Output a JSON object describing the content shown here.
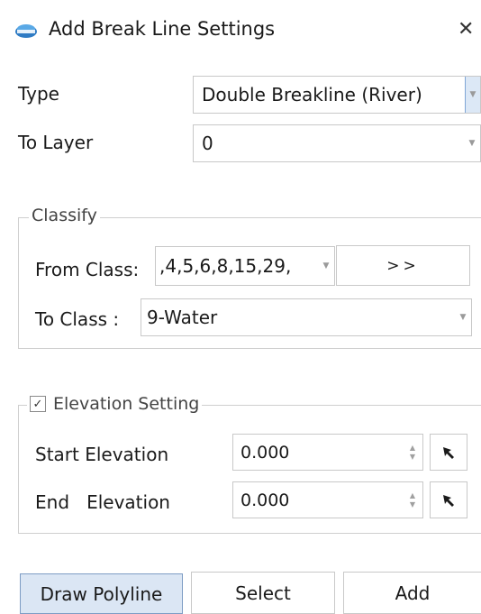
{
  "window": {
    "title": "Add Break Line Settings",
    "close_glyph": "✕"
  },
  "type_field": {
    "label": "Type",
    "value": "Double Breakline (River)"
  },
  "layer_field": {
    "label": "To Layer",
    "value": "0"
  },
  "classify": {
    "legend": "Classify",
    "from_label": "From Class:",
    "from_value": ",4,5,6,8,15,29,",
    "more_button": ">>",
    "to_label": "To Class :",
    "to_value": "9-Water"
  },
  "elevation": {
    "checked": true,
    "check_glyph": "✓",
    "legend": "Elevation Setting",
    "start_label": "Start Elevation",
    "start_value": "0.000",
    "end_label": "End   Elevation",
    "end_value": "0.000"
  },
  "buttons": {
    "draw": "Draw Polyline",
    "select": "Select",
    "add": "Add"
  },
  "icons": {
    "app": "lidar360-logo-icon",
    "close": "close-icon",
    "dropdown": "dropdown-arrow-icon",
    "spin": "spin-arrows-icon",
    "pick": "pick-point-icon"
  },
  "colors": {
    "active_button": "#dbe6f4",
    "accent_border": "#7d9cc4"
  }
}
